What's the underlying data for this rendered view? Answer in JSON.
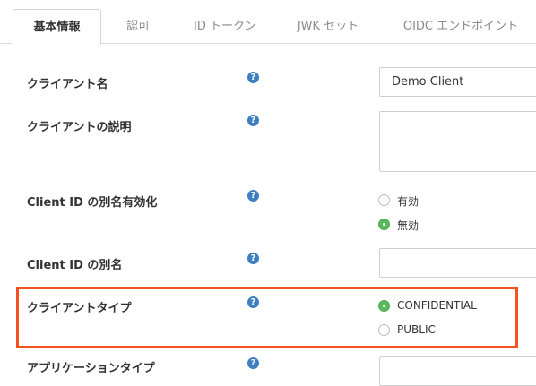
{
  "tabs": [
    {
      "label": "基本情報",
      "active": true
    },
    {
      "label": "認可"
    },
    {
      "label": "ID トークン"
    },
    {
      "label": "JWK セット"
    },
    {
      "label": "OIDC エンドポイント"
    }
  ],
  "help_glyph": "?",
  "form": {
    "client_name": {
      "label": "クライアント名",
      "value": "Demo Client"
    },
    "client_description": {
      "label": "クライアントの説明",
      "value": ""
    },
    "alias_enabled": {
      "label": "Client ID の別名有効化",
      "options": [
        {
          "label": "有効",
          "checked": false
        },
        {
          "label": "無効",
          "checked": true
        }
      ]
    },
    "alias": {
      "label": "Client ID の別名",
      "value": ""
    },
    "client_type": {
      "label": "クライアントタイプ",
      "options": [
        {
          "label": "CONFIDENTIAL",
          "checked": true
        },
        {
          "label": "PUBLIC",
          "checked": false
        }
      ]
    },
    "application_type": {
      "label": "アプリケーションタイプ"
    }
  },
  "colors": {
    "help_icon": "#3d7fc1",
    "radio_checked": "#5cb85c",
    "highlight_border": "#f4511e"
  }
}
